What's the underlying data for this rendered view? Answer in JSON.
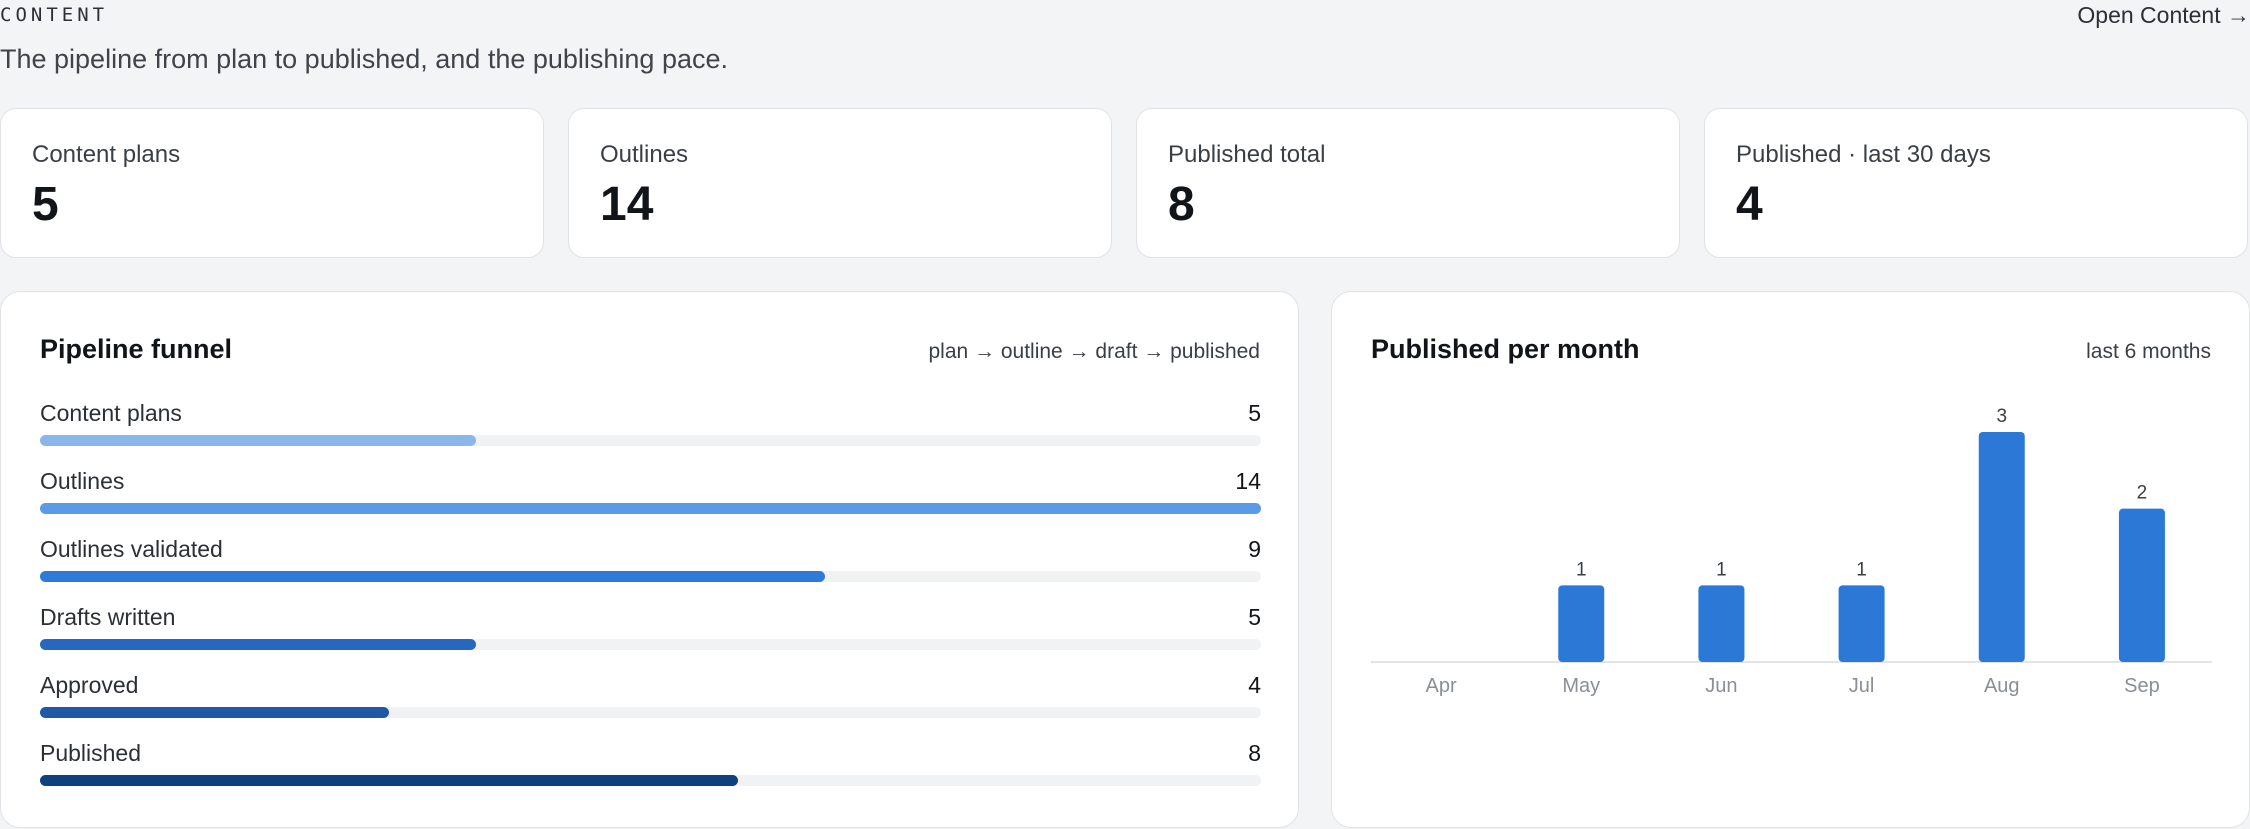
{
  "header": {
    "eyebrow": "CONTENT",
    "subtitle": "The pipeline from plan to published, and the publishing pace.",
    "open_link": "Open Content →"
  },
  "stats": [
    {
      "label": "Content plans",
      "value": "5"
    },
    {
      "label": "Outlines",
      "value": "14"
    },
    {
      "label": "Published total",
      "value": "8"
    },
    {
      "label": "Published · last 30 days",
      "value": "4"
    }
  ],
  "funnel": {
    "title": "Pipeline funnel",
    "note": "plan → outline → draft → published",
    "max": 14,
    "rows": [
      {
        "label": "Content plans",
        "count": 5,
        "color": "#8ab6ec"
      },
      {
        "label": "Outlines",
        "count": 14,
        "color": "#5b9ae6"
      },
      {
        "label": "Outlines validated",
        "count": 9,
        "color": "#2e7ad8"
      },
      {
        "label": "Drafts written",
        "count": 5,
        "color": "#2667c0"
      },
      {
        "label": "Approved",
        "count": 4,
        "color": "#1e58a6"
      },
      {
        "label": "Published",
        "count": 8,
        "color": "#123f7e"
      }
    ]
  },
  "monthly": {
    "title": "Published per month",
    "note": "last 6 months"
  },
  "chart_data": {
    "type": "bar",
    "title": "Published per month",
    "categories": [
      "Apr",
      "May",
      "Jun",
      "Jul",
      "Aug",
      "Sep"
    ],
    "values": [
      0,
      1,
      1,
      1,
      3,
      2
    ],
    "ylim": [
      0,
      3
    ],
    "grid": false,
    "bar_color": "#2b78d6"
  }
}
